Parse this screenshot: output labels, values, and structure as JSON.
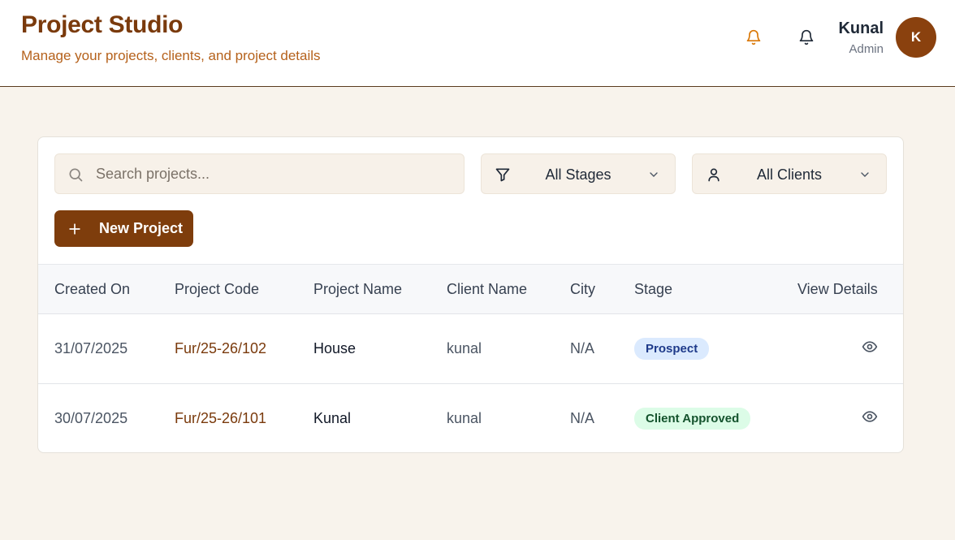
{
  "header": {
    "title": "Project Studio",
    "subtitle": "Manage your projects, clients, and project details",
    "user": {
      "name": "Kunal",
      "role": "Admin",
      "initial": "K"
    },
    "colors": {
      "brand": "#7a3a0c",
      "accent": "#d97706"
    }
  },
  "toolbar": {
    "search_placeholder": "Search projects...",
    "stage_filter": "All Stages",
    "client_filter": "All Clients",
    "new_project_label": "New Project"
  },
  "table": {
    "columns": [
      "Created On",
      "Project Code",
      "Project Name",
      "Client Name",
      "City",
      "Stage",
      "View Details"
    ],
    "rows": [
      {
        "created_on": "31/07/2025",
        "code": "Fur/25-26/102",
        "name": "House",
        "client": "kunal",
        "city": "N/A",
        "stage": "Prospect"
      },
      {
        "created_on": "30/07/2025",
        "code": "Fur/25-26/101",
        "name": "Kunal",
        "client": "kunal",
        "city": "N/A",
        "stage": "Client Approved"
      }
    ]
  },
  "icons": [
    "bell-icon",
    "search-icon",
    "filter-icon",
    "user-icon",
    "chevron-down-icon",
    "plus-icon",
    "eye-icon"
  ]
}
